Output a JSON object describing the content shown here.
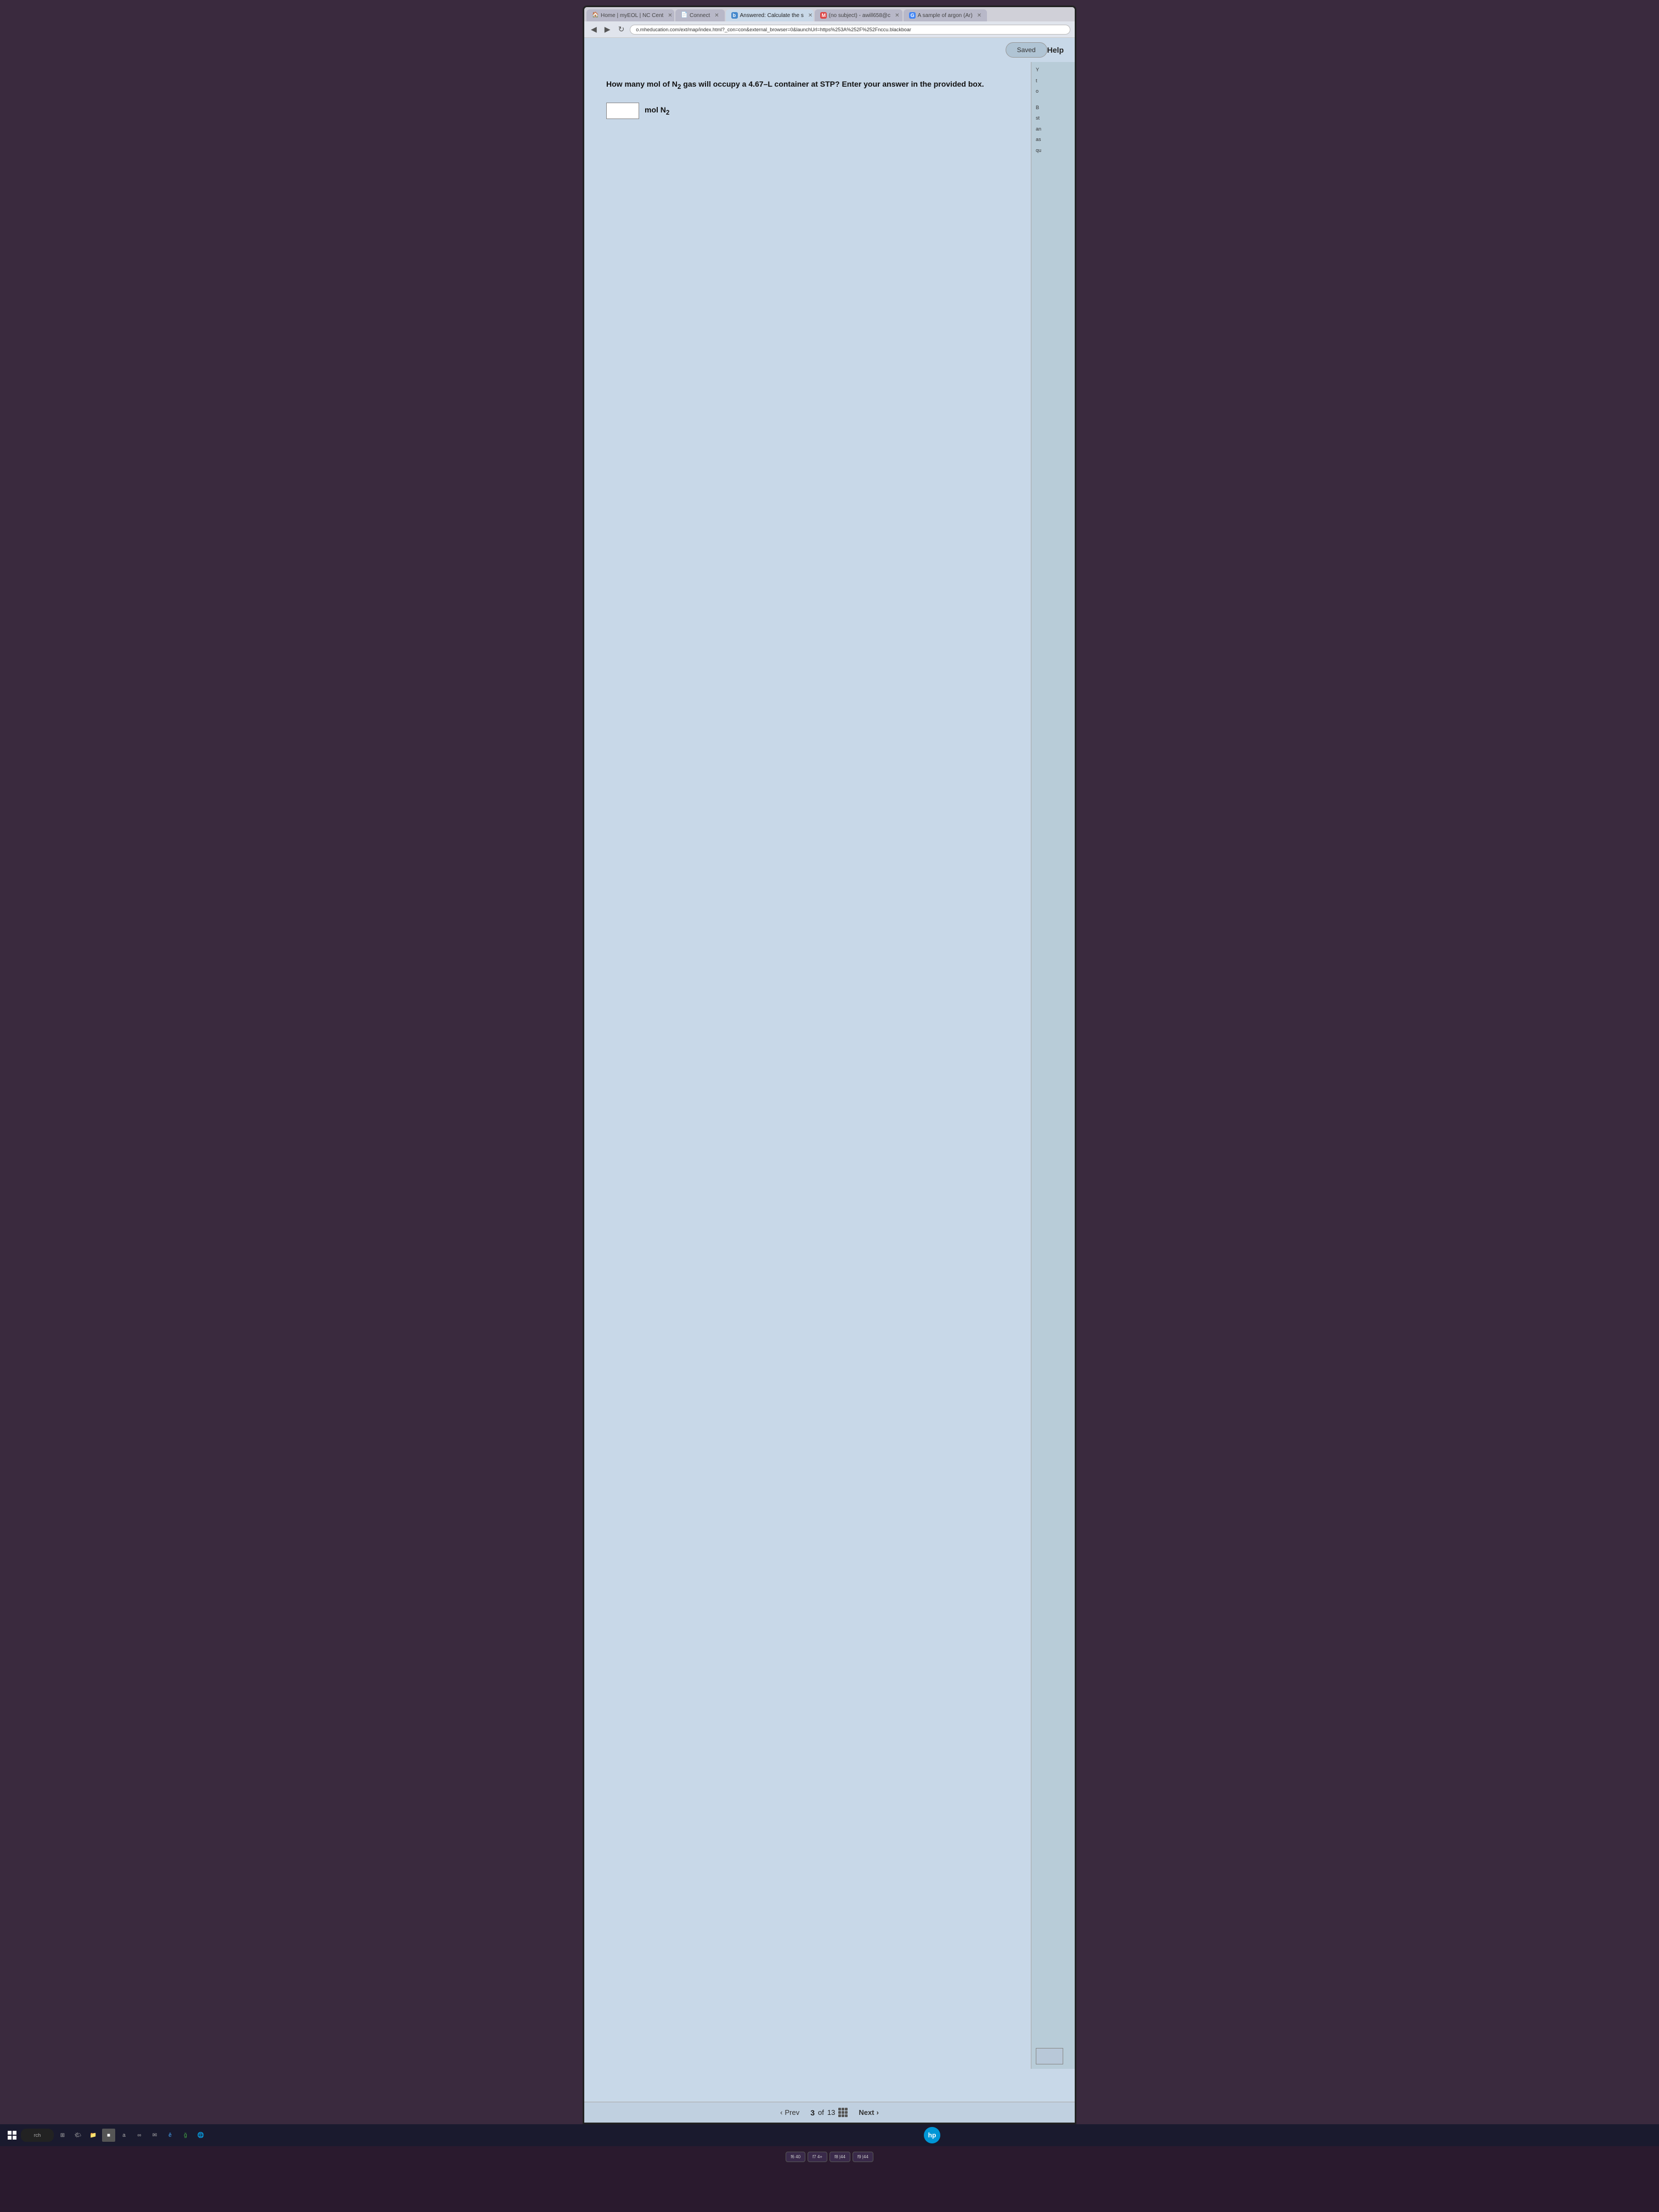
{
  "browser": {
    "tabs": [
      {
        "id": "tab-home",
        "label": "Home | myEOL | NC Cent",
        "active": false,
        "favicon": "🏠"
      },
      {
        "id": "tab-connect",
        "label": "Connect",
        "active": false,
        "favicon": "📄"
      },
      {
        "id": "tab-answered",
        "label": "Answered: Calculate the s",
        "active": true,
        "favicon": "b"
      },
      {
        "id": "tab-email",
        "label": "(no subject) - awill658@c",
        "active": false,
        "favicon": "M"
      },
      {
        "id": "tab-argon",
        "label": "A sample of argon (Ar)",
        "active": false,
        "favicon": "G"
      }
    ],
    "address_bar": "o.mheducation.com/ext/map/index.html?_con=con&external_browser=0&launchUrl=https%253A%252F%252Fnccu.blackboar"
  },
  "toolbar": {
    "saved_label": "Saved",
    "help_label": "Help"
  },
  "question": {
    "text": "How many mol of N",
    "subscript": "2",
    "text2": " gas will occupy a 4.67–L container at STP? Enter your answer in the provided box.",
    "answer_placeholder": "",
    "unit_label": "mol N",
    "unit_subscript": "2"
  },
  "navigation": {
    "prev_label": "Prev",
    "next_label": "Next",
    "current_page": "3",
    "total_pages": "13",
    "of_label": "of"
  },
  "side_panel": {
    "lines": [
      "Y",
      "t",
      "o",
      "",
      "B",
      "st",
      "an",
      "as",
      "qu"
    ]
  },
  "taskbar": {
    "search_label": "rch",
    "hp_label": "hp"
  },
  "keyboard": {
    "visible_keys": [
      "f6 40",
      "f7 4+",
      "f8 |44",
      "f9 |44"
    ]
  }
}
